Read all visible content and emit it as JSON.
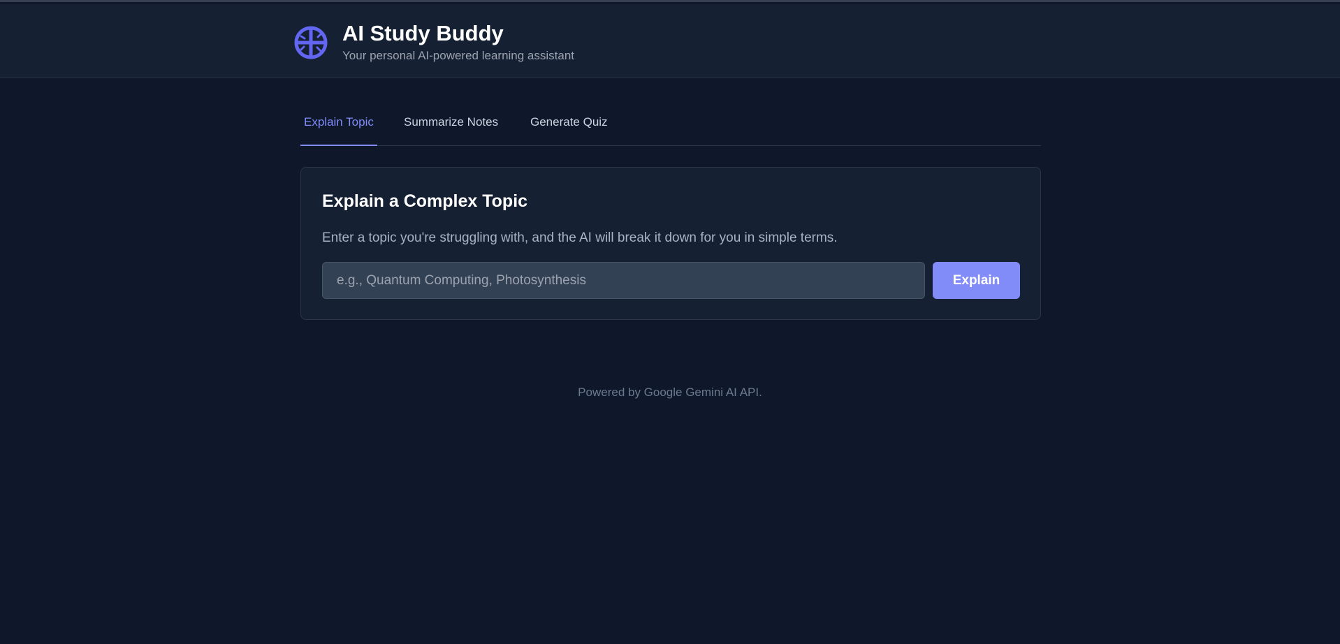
{
  "header": {
    "logo_icon": "brain-globe-icon",
    "title": "AI Study Buddy",
    "subtitle": "Your personal AI-powered learning assistant"
  },
  "tabs": [
    {
      "label": "Explain Topic",
      "active": true
    },
    {
      "label": "Summarize Notes",
      "active": false
    },
    {
      "label": "Generate Quiz",
      "active": false
    }
  ],
  "card": {
    "title": "Explain a Complex Topic",
    "description": "Enter a topic you're struggling with, and the AI will break it down for you in simple terms.",
    "input": {
      "value": "",
      "placeholder": "e.g., Quantum Computing, Photosynthesis"
    },
    "button_label": "Explain"
  },
  "footer": {
    "text": "Powered by Google Gemini AI API."
  },
  "colors": {
    "background": "#0f172a",
    "header_background": "#152033",
    "accent": "#818cf8",
    "logo": "#6366f1"
  }
}
